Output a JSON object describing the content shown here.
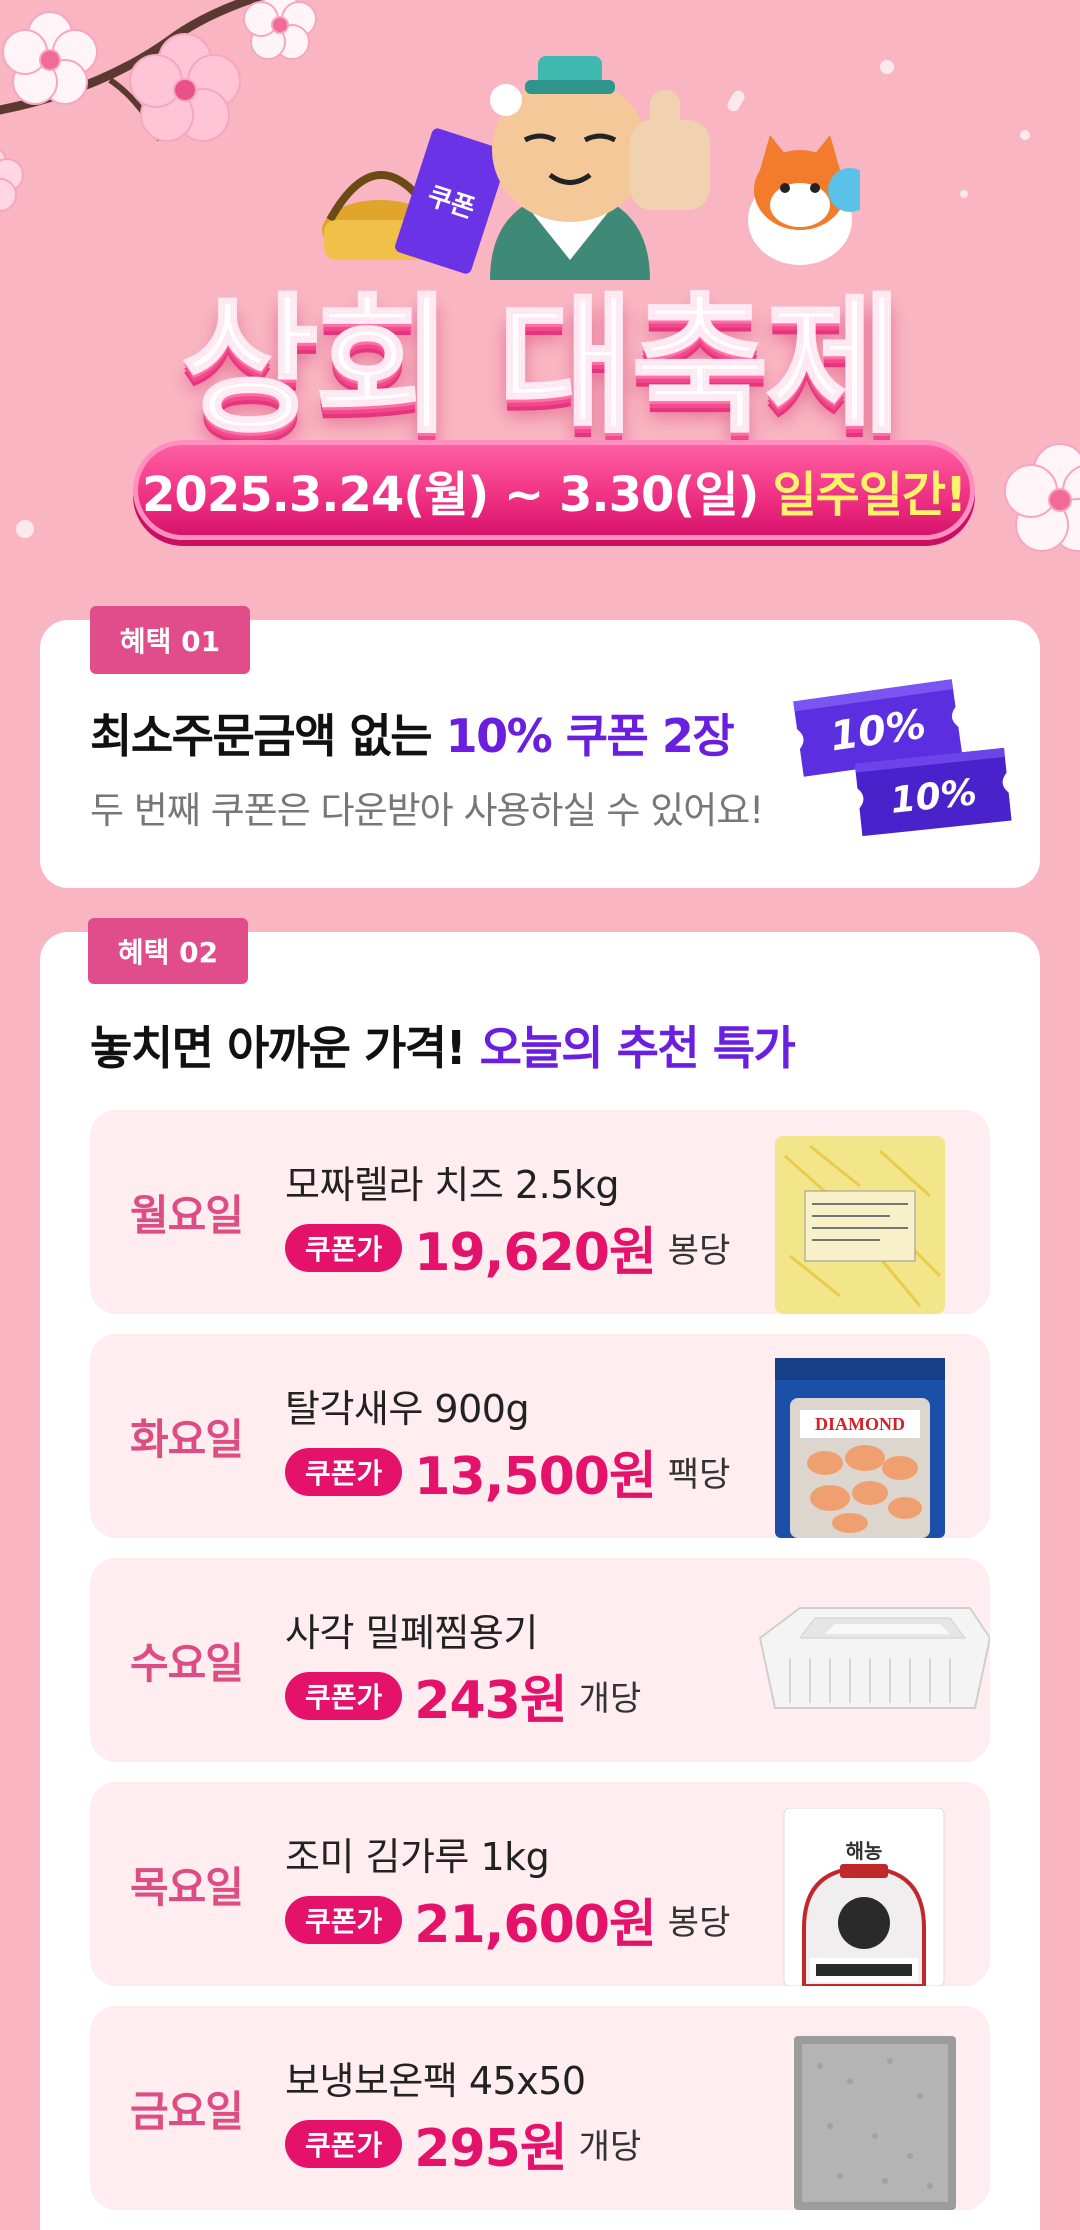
{
  "hero": {
    "title": "상회 대축제",
    "date_text": "2025.3.24(월) ~ 3.30(일)",
    "date_highlight": "일주일간!",
    "mascot_coupon_text": "쿠폰"
  },
  "benefit1": {
    "badge": "혜택 01",
    "title_prefix": "최소주문금액 없는 ",
    "title_accent": "10% 쿠폰 2장",
    "subtitle": "두 번째 쿠폰은 다운받아 사용하실 수 있어요!",
    "coupon_label_1": "10%",
    "coupon_label_2": "10%"
  },
  "benefit2": {
    "badge": "혜택 02",
    "title_prefix": "놓치면 아까운 가격! ",
    "title_accent": "오늘의 추천 특가",
    "deals": [
      {
        "day": "월요일",
        "name": "모짜렐라 치즈 2.5kg",
        "tag": "쿠폰가",
        "price": "19,620원",
        "unit": "봉당",
        "image": "cheese-bag"
      },
      {
        "day": "화요일",
        "name": "탈각새우 900g",
        "tag": "쿠폰가",
        "price": "13,500원",
        "unit": "팩당",
        "image": "shrimp-pack",
        "image_text": "DIAMOND"
      },
      {
        "day": "수요일",
        "name": "사각 밀폐찜용기",
        "tag": "쿠폰가",
        "price": "243원",
        "unit": "개당",
        "image": "container"
      },
      {
        "day": "목요일",
        "name": "조미 김가루 1kg",
        "tag": "쿠폰가",
        "price": "21,600원",
        "unit": "봉당",
        "image": "seaweed-bag",
        "image_text": "해농"
      },
      {
        "day": "금요일",
        "name": "보냉보온팩 45x50",
        "tag": "쿠폰가",
        "price": "295원",
        "unit": "개당",
        "image": "insulated-pack"
      }
    ]
  },
  "colors": {
    "background": "#f9b6c2",
    "accent_pink": "#e5126b",
    "accent_purple": "#6a1ee0",
    "day_pink": "#dc4d83",
    "deal_bg": "#ffedf0"
  }
}
